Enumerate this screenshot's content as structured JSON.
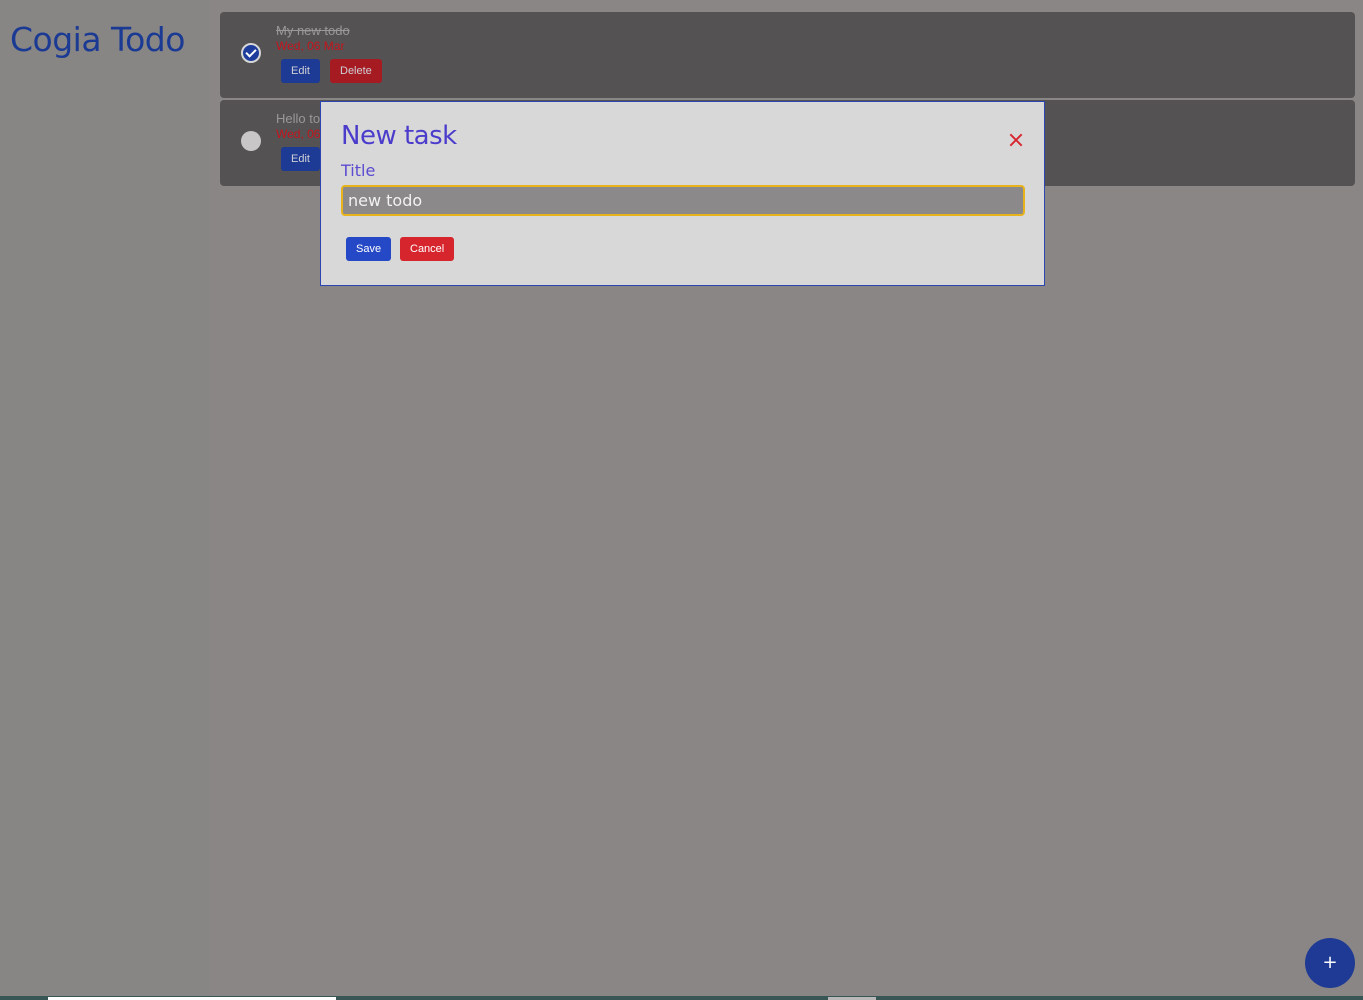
{
  "app": {
    "title": "Cogia Todo"
  },
  "todos": [
    {
      "title": "My new todo",
      "date": "Wed, 06 Mar",
      "completed": true,
      "edit_label": "Edit",
      "delete_label": "Delete"
    },
    {
      "title": "Hello to",
      "date": "Wed, 06",
      "completed": false,
      "edit_label": "Edit"
    }
  ],
  "modal": {
    "title": "New task",
    "field_label": "Title",
    "input_value": "new todo",
    "save_label": "Save",
    "cancel_label": "Cancel",
    "close_icon": "close-icon"
  },
  "fab": {
    "label": "+"
  },
  "colors": {
    "accent": "#1f3a95",
    "danger": "#d7252d",
    "modal_title": "#4b3ccc",
    "input_focus": "#e8b21a"
  }
}
